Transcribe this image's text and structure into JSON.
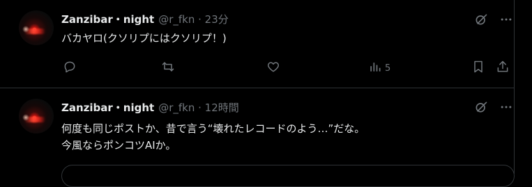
{
  "tweets": [
    {
      "display_name": "Zanzibar・night",
      "meta": "@r_fkn · 23分",
      "text": "バカヤロ(クソリプにはクソリプ！)",
      "views": "5"
    },
    {
      "display_name": "Zanzibar・night",
      "meta": "@r_fkn · 12時間",
      "text_line1": "何度も同じポストか、昔で言う“壊れたレコードのよう…”だな。",
      "text_line2": "今風ならポンコツAIか。"
    }
  ],
  "icons": {
    "grok": "grok-icon",
    "more": "more-icon",
    "reply": "reply-icon",
    "retweet": "retweet-icon",
    "like": "heart-icon",
    "views": "views-chart-icon",
    "bookmark": "bookmark-icon",
    "share": "share-icon"
  },
  "colors": {
    "background": "#000000",
    "text": "#e7e9ea",
    "muted": "#71767b",
    "divider": "#2f3336"
  }
}
